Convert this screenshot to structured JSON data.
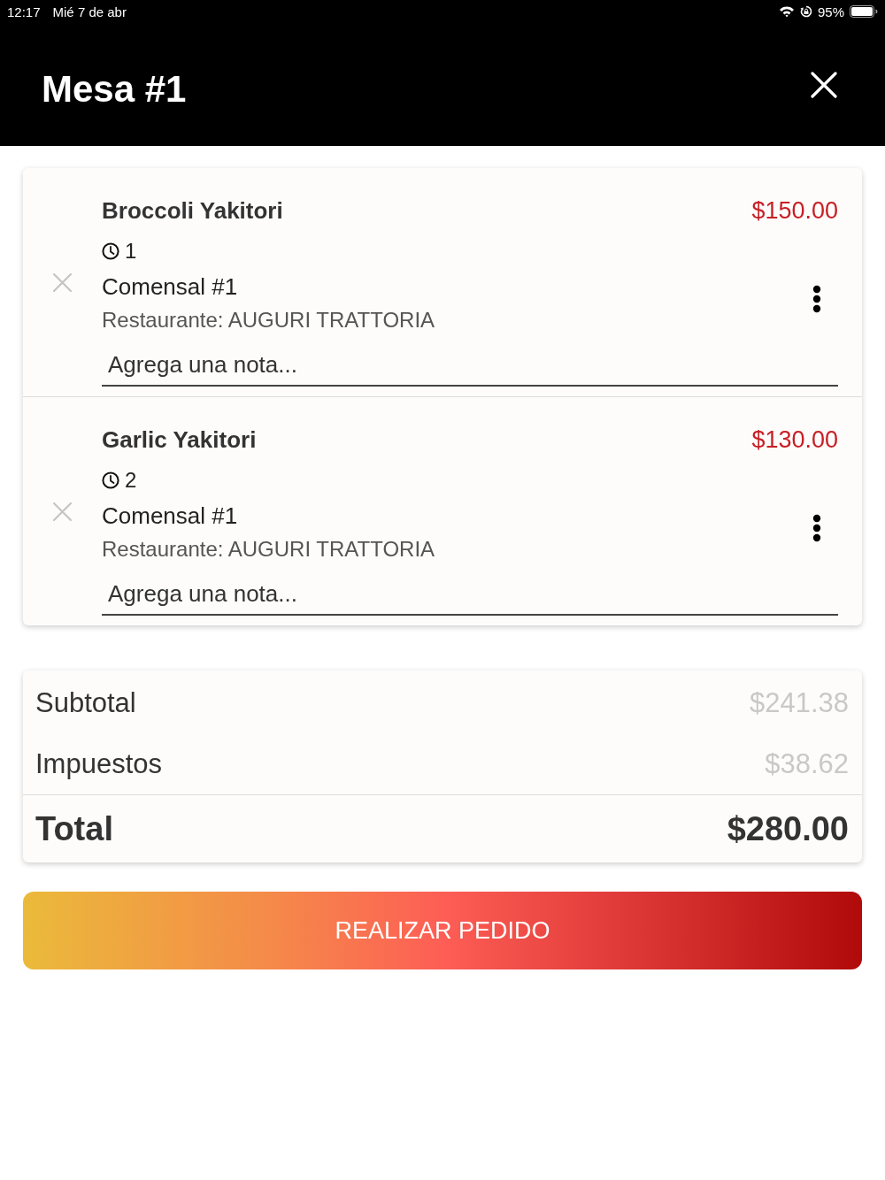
{
  "status_bar": {
    "time": "12:17",
    "date": "Mié 7 de abr",
    "battery": "95%"
  },
  "header": {
    "title": "Mesa #1"
  },
  "order_items": [
    {
      "name": "Broccoli Yakitori",
      "price": "$150.00",
      "time": "1",
      "diner": "Comensal #1",
      "restaurant": "Restaurante: AUGURI TRATTORIA",
      "note": {
        "placeholder": "Agrega una nota..."
      }
    },
    {
      "name": "Garlic Yakitori",
      "price": "$130.00",
      "time": "2",
      "diner": "Comensal #1",
      "restaurant": "Restaurante: AUGURI TRATTORIA",
      "note": {
        "placeholder": "Agrega una nota..."
      }
    }
  ],
  "summary": {
    "rows": [
      {
        "kind": "line",
        "label": "Subtotal",
        "value": "$241.38"
      },
      {
        "kind": "line",
        "label": "Impuestos",
        "value": "$38.62"
      },
      {
        "kind": "total",
        "label": "Total",
        "value": "$280.00"
      }
    ]
  },
  "submit_button": {
    "label": "REALIZAR PEDIDO"
  }
}
